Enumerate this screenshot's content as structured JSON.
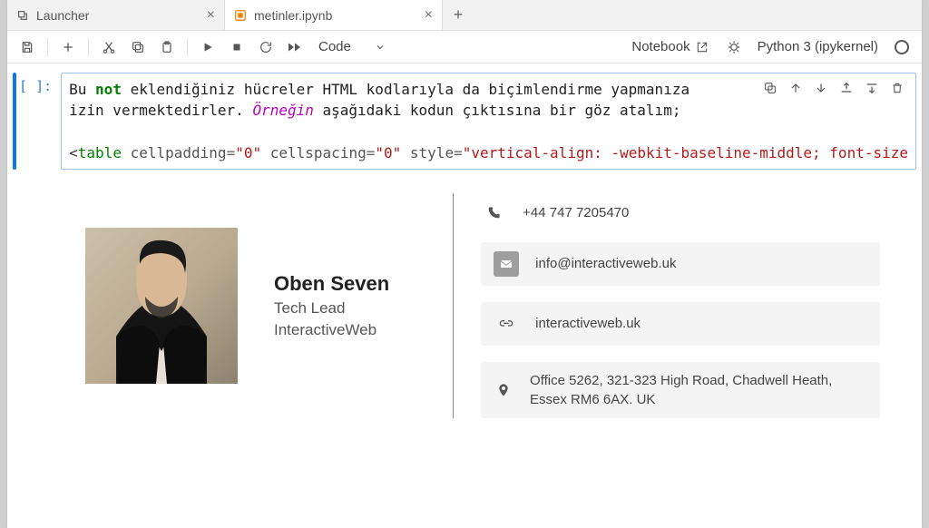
{
  "tabs": [
    {
      "label": "Launcher",
      "active": false
    },
    {
      "label": "metinler.ipynb",
      "active": true
    }
  ],
  "toolbar": {
    "cell_type": "Code",
    "notebook_label": "Notebook",
    "kernel_label": "Python 3 (ipykernel)"
  },
  "cell": {
    "prompt": "[ ]:",
    "code_plain_line1": "Bu not eklendiğiniz hücreler HTML kodlarıyla da biçimlendirme yapmanıza",
    "code_plain_line2": "izin vermektedirler. Örneğin aşağıdaki kodun çıktısına bir göz atalım;",
    "code_tokens_line1": {
      "w0": "Bu ",
      "w1": "not",
      "w2": " eklendiğiniz hücreler HTML kodlarıyla da biçimlendirme yapmanıza"
    },
    "code_tokens_line2": {
      "w0": "izin vermektedirler. ",
      "w1": "Örneğin",
      "w2": " aşağıdaki kodun çıktısına bir göz atalım;"
    },
    "code_tokens_line4": {
      "lt": "<",
      "tag": "table",
      "sp": " ",
      "a1": "cellpadding",
      "eq1": "=",
      "v1": "\"0\"",
      "a2": "cellspacing",
      "eq2": "=",
      "v2": "\"0\"",
      "a3": "style",
      "eq3": "=",
      "v3": "\"vertical-align: -webkit-baseline-middle; font-size"
    }
  },
  "signature": {
    "name": "Oben Seven",
    "role": "Tech Lead",
    "company": "InteractiveWeb",
    "phone": "+44 747 7205470",
    "email": "info@interactiveweb.uk",
    "website": "interactiveweb.uk",
    "address": "Office 5262, 321-323 High Road, Chadwell Heath, Essex RM6 6AX. UK"
  }
}
